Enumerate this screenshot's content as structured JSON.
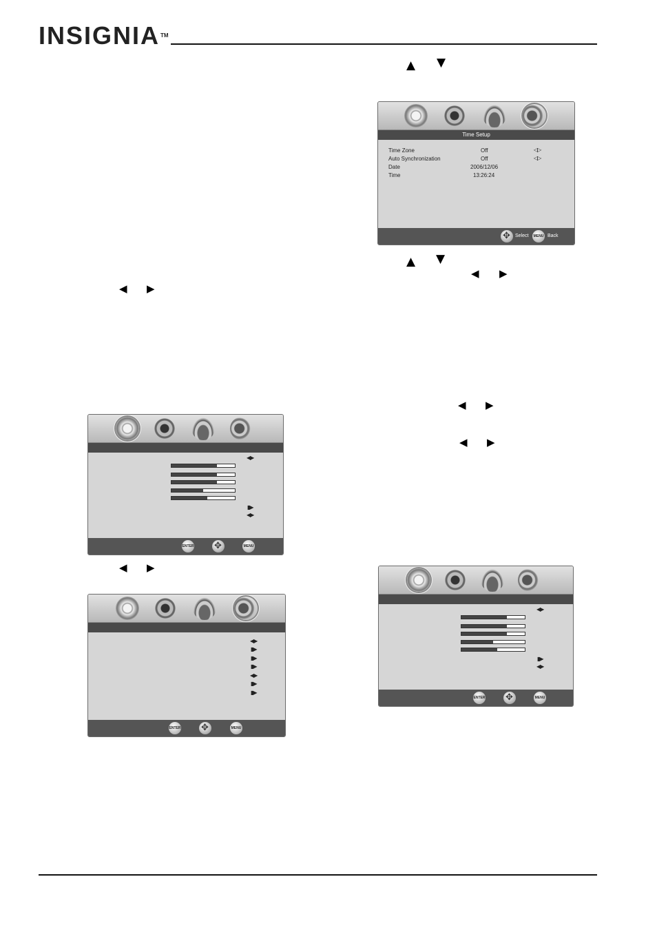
{
  "header": {
    "brand": "INSIGNIA",
    "trademark": "TM"
  },
  "arrows": {
    "up": "▲",
    "down": "▼",
    "left": "◀",
    "right": "▶"
  },
  "time_setup": {
    "title": "Time Setup",
    "rows": [
      {
        "label": "Time Zone",
        "value": "Off",
        "indicator": "◁▷"
      },
      {
        "label": "Auto Synchronization",
        "value": "Off",
        "indicator": "◁▷"
      },
      {
        "label": "Date",
        "value": "2006/12/06",
        "indicator": ""
      },
      {
        "label": "Time",
        "value": "13:26:24",
        "indicator": ""
      }
    ],
    "footer": {
      "select_label": "Select",
      "menu_label": "MENU",
      "back_label": "Back"
    }
  },
  "picture_menu_1": {
    "indicators": [
      "◀▶",
      "▮▶",
      "◀▶"
    ],
    "bars": [
      0.72,
      0.72,
      0.72,
      0.5,
      0.57
    ]
  },
  "general_menu": {
    "indicators": [
      "◀▶",
      "▮▶",
      "▮▶",
      "▮▶",
      "◀▶",
      "▮▶",
      "▮▶"
    ]
  },
  "picture_menu_2": {
    "indicators": [
      "◀▶",
      "▮▶",
      "◀▶"
    ],
    "bars": [
      0.72,
      0.72,
      0.72,
      0.5,
      0.57
    ]
  },
  "footer_buttons": {
    "enter": "ENTER",
    "menu": "MENU"
  },
  "icons": [
    "disc-icon",
    "speaker-icon",
    "setup-icon",
    "language-icon"
  ]
}
